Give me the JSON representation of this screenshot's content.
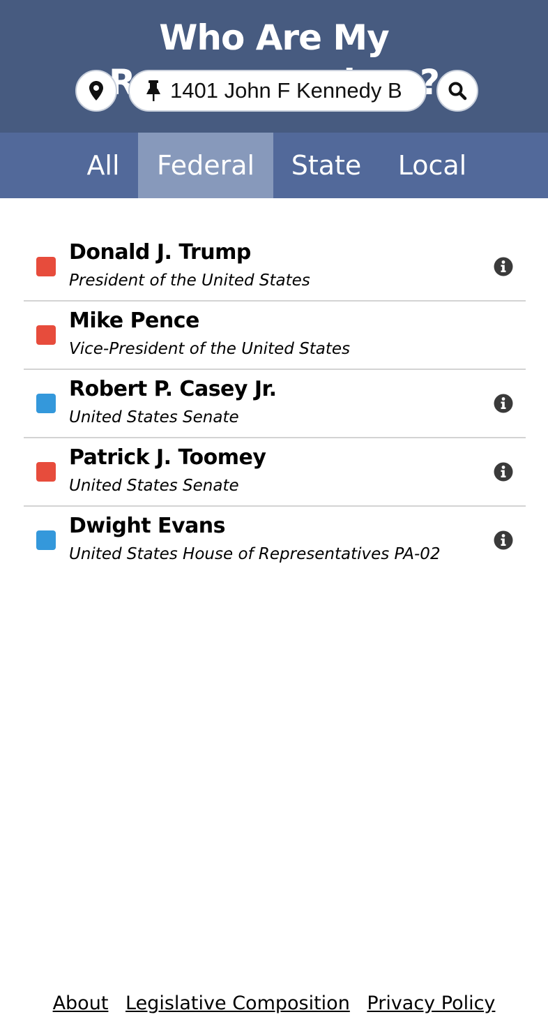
{
  "header": {
    "title": "Who Are My Representatives?",
    "locate_icon": "map-marker-icon",
    "pin_icon": "thumbtack-icon",
    "search_icon": "search-icon",
    "address_value": "1401 John F Kennedy B"
  },
  "tabs": [
    {
      "label": "All",
      "active": false
    },
    {
      "label": "Federal",
      "active": true
    },
    {
      "label": "State",
      "active": false
    },
    {
      "label": "Local",
      "active": false
    }
  ],
  "representatives": [
    {
      "name": "Donald J. Trump",
      "office": "President of the United States",
      "party_color": "#e74c3c",
      "info_icon": true
    },
    {
      "name": "Mike Pence",
      "office": "Vice-President of the United States",
      "party_color": "#e74c3c",
      "info_icon": false
    },
    {
      "name": "Robert P. Casey Jr.",
      "office": "United States Senate",
      "party_color": "#3498db",
      "info_icon": true
    },
    {
      "name": "Patrick J. Toomey",
      "office": "United States Senate",
      "party_color": "#e74c3c",
      "info_icon": true
    },
    {
      "name": "Dwight Evans",
      "office": "United States House of Representatives PA-02",
      "party_color": "#3498db",
      "info_icon": true
    }
  ],
  "footer": {
    "about": "About",
    "legislative_composition": "Legislative Composition",
    "privacy_policy": "Privacy Policy"
  },
  "colors": {
    "header_bg": "#475b80",
    "tabs_bg": "#52699a",
    "active_tab_bg": "#8799bb",
    "republican": "#e74c3c",
    "democrat": "#3498db"
  }
}
